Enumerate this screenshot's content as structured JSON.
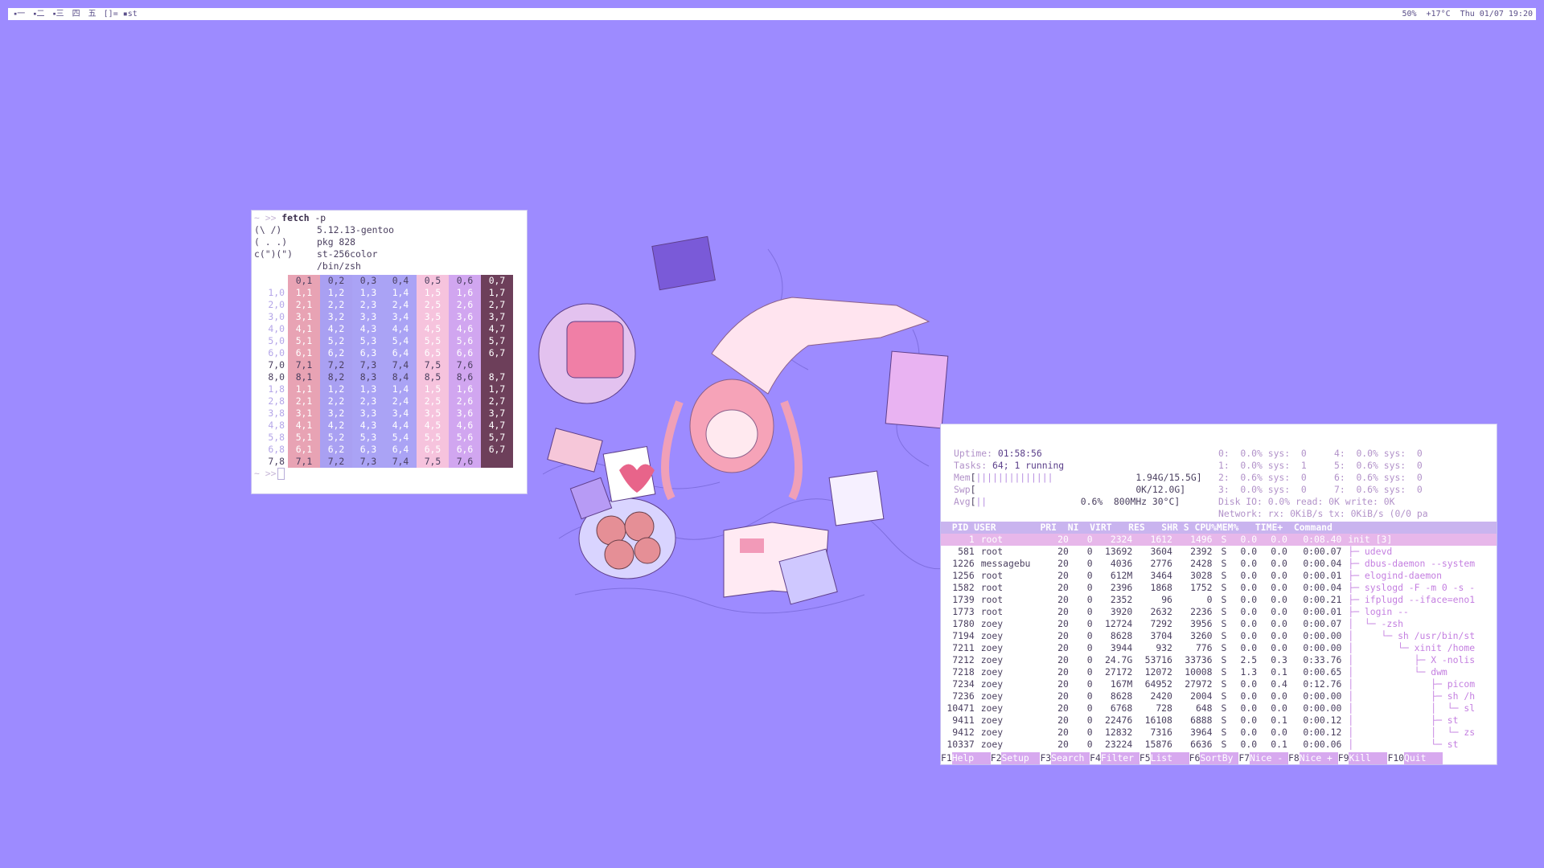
{
  "topbar": {
    "tags": [
      "一",
      "二",
      "三",
      "四",
      "五"
    ],
    "layout": "[]=",
    "window_title": "st",
    "status": "50%  +17°C  Thu 01/07 19:20"
  },
  "fetch": {
    "prompt": "~ >>",
    "command": "fetch",
    "arg": "-p",
    "art": [
      "(\\ /)",
      "( . .)",
      "c(\")(\")",
      ""
    ],
    "info": [
      "5.12.13-gentoo",
      "pkg 828",
      "st-256color",
      "/bin/zsh"
    ],
    "grid_header": [
      "",
      "0,1",
      "0,2",
      "0,3",
      "0,4",
      "0,5",
      "0,6",
      "0,7"
    ],
    "grid_rows": [
      [
        "1,0",
        "1,1",
        "1,2",
        "1,3",
        "1,4",
        "1,5",
        "1,6",
        "1,7"
      ],
      [
        "2,0",
        "2,1",
        "2,2",
        "2,3",
        "2,4",
        "2,5",
        "2,6",
        "2,7"
      ],
      [
        "3,0",
        "3,1",
        "3,2",
        "3,3",
        "3,4",
        "3,5",
        "3,6",
        "3,7"
      ],
      [
        "4,0",
        "4,1",
        "4,2",
        "4,3",
        "4,4",
        "4,5",
        "4,6",
        "4,7"
      ],
      [
        "5,0",
        "5,1",
        "5,2",
        "5,3",
        "5,4",
        "5,5",
        "5,6",
        "5,7"
      ],
      [
        "6,0",
        "6,1",
        "6,2",
        "6,3",
        "6,4",
        "6,5",
        "6,6",
        "6,7"
      ],
      [
        "7,0",
        "7,1",
        "7,2",
        "7,3",
        "7,4",
        "7,5",
        "7,6",
        ""
      ],
      [
        "8,0",
        "8,1",
        "8,2",
        "8,3",
        "8,4",
        "8,5",
        "8,6",
        "8,7"
      ],
      [
        "1,8",
        "1,1",
        "1,2",
        "1,3",
        "1,4",
        "1,5",
        "1,6",
        "1,7"
      ],
      [
        "2,8",
        "2,1",
        "2,2",
        "2,3",
        "2,4",
        "2,5",
        "2,6",
        "2,7"
      ],
      [
        "3,8",
        "3,1",
        "3,2",
        "3,3",
        "3,4",
        "3,5",
        "3,6",
        "3,7"
      ],
      [
        "4,8",
        "4,1",
        "4,2",
        "4,3",
        "4,4",
        "4,5",
        "4,6",
        "4,7"
      ],
      [
        "5,8",
        "5,1",
        "5,2",
        "5,3",
        "5,4",
        "5,5",
        "5,6",
        "5,7"
      ],
      [
        "6,8",
        "6,1",
        "6,2",
        "6,3",
        "6,4",
        "6,5",
        "6,6",
        "6,7"
      ],
      [
        "7,8",
        "7,1",
        "7,2",
        "7,3",
        "7,4",
        "7,5",
        "7,6",
        ""
      ]
    ],
    "column_colors": [
      "#ffffff",
      "#e8a3b4",
      "#a9a0f2",
      "#aaa3f5",
      "#aaa3f5",
      "#f6c3dd",
      "#d1a6f0",
      "#6d3f5a"
    ]
  },
  "htop": {
    "uptime_label": "Uptime:",
    "uptime": "01:58:56",
    "tasks_label": "Tasks:",
    "tasks": "64; 1 running",
    "mem_label": "Mem",
    "mem_bar": "||||||||||||||",
    "mem_val": "1.94G/15.5G",
    "swp_label": "Swp",
    "swp_val": "0K/12.0G",
    "avg_label": "Avg",
    "avg_bar": "||",
    "avg_val": "0.6%  800MHz 30°C",
    "disk": "Disk IO: 0.0% read: 0K write: 0K",
    "network": "Network: rx: 0KiB/s tx: 0KiB/s (0/0 pa",
    "cpus": [
      "0:  0.0% sys:  0     4:  0.0% sys:  0",
      "1:  0.0% sys:  1     5:  0.6% sys:  0",
      "2:  0.6% sys:  0     6:  0.6% sys:  0",
      "3:  0.0% sys:  0     7:  0.6% sys:  0"
    ],
    "header": "  PID USER        PRI  NI  VIRT   RES   SHR S CPU%MEM%   TIME+  Command",
    "processes": [
      {
        "pid": "1",
        "user": "root",
        "pri": "20",
        "ni": "0",
        "virt": "2324",
        "res": "1612",
        "shr": "1496",
        "s": "S",
        "cpu": "0.0",
        "mem": "0.0",
        "time": "0:08.40",
        "cmd": "init [3]",
        "sel": true
      },
      {
        "pid": "581",
        "user": "root",
        "pri": "20",
        "ni": "0",
        "virt": "13692",
        "res": "3604",
        "shr": "2392",
        "s": "S",
        "cpu": "0.0",
        "mem": "0.0",
        "time": "0:00.07",
        "cmd": "├─ udevd"
      },
      {
        "pid": "1226",
        "user": "messagebu",
        "pri": "20",
        "ni": "0",
        "virt": "4036",
        "res": "2776",
        "shr": "2428",
        "s": "S",
        "cpu": "0.0",
        "mem": "0.0",
        "time": "0:00.04",
        "cmd": "├─ dbus-daemon --system"
      },
      {
        "pid": "1256",
        "user": "root",
        "pri": "20",
        "ni": "0",
        "virt": "612M",
        "res": "3464",
        "shr": "3028",
        "s": "S",
        "cpu": "0.0",
        "mem": "0.0",
        "time": "0:00.01",
        "cmd": "├─ elogind-daemon"
      },
      {
        "pid": "1582",
        "user": "root",
        "pri": "20",
        "ni": "0",
        "virt": "2396",
        "res": "1868",
        "shr": "1752",
        "s": "S",
        "cpu": "0.0",
        "mem": "0.0",
        "time": "0:00.04",
        "cmd": "├─ syslogd -F -m 0 -s -"
      },
      {
        "pid": "1739",
        "user": "root",
        "pri": "20",
        "ni": "0",
        "virt": "2352",
        "res": "96",
        "shr": "0",
        "s": "S",
        "cpu": "0.0",
        "mem": "0.0",
        "time": "0:00.21",
        "cmd": "├─ ifplugd --iface=eno1"
      },
      {
        "pid": "1773",
        "user": "root",
        "pri": "20",
        "ni": "0",
        "virt": "3920",
        "res": "2632",
        "shr": "2236",
        "s": "S",
        "cpu": "0.0",
        "mem": "0.0",
        "time": "0:00.01",
        "cmd": "├─ login --"
      },
      {
        "pid": "1780",
        "user": "zoey",
        "pri": "20",
        "ni": "0",
        "virt": "12724",
        "res": "7292",
        "shr": "3956",
        "s": "S",
        "cpu": "0.0",
        "mem": "0.0",
        "time": "0:00.07",
        "cmd": "│  └─ -zsh"
      },
      {
        "pid": "7194",
        "user": "zoey",
        "pri": "20",
        "ni": "0",
        "virt": "8628",
        "res": "3704",
        "shr": "3260",
        "s": "S",
        "cpu": "0.0",
        "mem": "0.0",
        "time": "0:00.00",
        "cmd": "│     └─ sh /usr/bin/st"
      },
      {
        "pid": "7211",
        "user": "zoey",
        "pri": "20",
        "ni": "0",
        "virt": "3944",
        "res": "932",
        "shr": "776",
        "s": "S",
        "cpu": "0.0",
        "mem": "0.0",
        "time": "0:00.00",
        "cmd": "│        └─ xinit /home"
      },
      {
        "pid": "7212",
        "user": "zoey",
        "pri": "20",
        "ni": "0",
        "virt": "24.7G",
        "res": "53716",
        "shr": "33736",
        "s": "S",
        "cpu": "2.5",
        "mem": "0.3",
        "time": "0:33.76",
        "cmd": "│           ├─ X -nolis"
      },
      {
        "pid": "7218",
        "user": "zoey",
        "pri": "20",
        "ni": "0",
        "virt": "27172",
        "res": "12072",
        "shr": "10008",
        "s": "S",
        "cpu": "1.3",
        "mem": "0.1",
        "time": "0:00.65",
        "cmd": "│           └─ dwm"
      },
      {
        "pid": "7234",
        "user": "zoey",
        "pri": "20",
        "ni": "0",
        "virt": "167M",
        "res": "64952",
        "shr": "27972",
        "s": "S",
        "cpu": "0.0",
        "mem": "0.4",
        "time": "0:12.76",
        "cmd": "│              ├─ picom"
      },
      {
        "pid": "7236",
        "user": "zoey",
        "pri": "20",
        "ni": "0",
        "virt": "8628",
        "res": "2420",
        "shr": "2004",
        "s": "S",
        "cpu": "0.0",
        "mem": "0.0",
        "time": "0:00.00",
        "cmd": "│              ├─ sh /h"
      },
      {
        "pid": "10471",
        "user": "zoey",
        "pri": "20",
        "ni": "0",
        "virt": "6768",
        "res": "728",
        "shr": "648",
        "s": "S",
        "cpu": "0.0",
        "mem": "0.0",
        "time": "0:00.00",
        "cmd": "│              │  └─ sl"
      },
      {
        "pid": "9411",
        "user": "zoey",
        "pri": "20",
        "ni": "0",
        "virt": "22476",
        "res": "16108",
        "shr": "6888",
        "s": "S",
        "cpu": "0.0",
        "mem": "0.1",
        "time": "0:00.12",
        "cmd": "│              ├─ st"
      },
      {
        "pid": "9412",
        "user": "zoey",
        "pri": "20",
        "ni": "0",
        "virt": "12832",
        "res": "7316",
        "shr": "3964",
        "s": "S",
        "cpu": "0.0",
        "mem": "0.0",
        "time": "0:00.12",
        "cmd": "│              │  └─ zs"
      },
      {
        "pid": "10337",
        "user": "zoey",
        "pri": "20",
        "ni": "0",
        "virt": "23224",
        "res": "15876",
        "shr": "6636",
        "s": "S",
        "cpu": "0.0",
        "mem": "0.1",
        "time": "0:00.06",
        "cmd": "│              └─ st"
      }
    ],
    "fkeys": [
      {
        "k": "F1",
        "l": "Help"
      },
      {
        "k": "F2",
        "l": "Setup"
      },
      {
        "k": "F3",
        "l": "Search"
      },
      {
        "k": "F4",
        "l": "Filter"
      },
      {
        "k": "F5",
        "l": "List"
      },
      {
        "k": "F6",
        "l": "SortBy"
      },
      {
        "k": "F7",
        "l": "Nice -"
      },
      {
        "k": "F8",
        "l": "Nice +"
      },
      {
        "k": "F9",
        "l": "Kill"
      },
      {
        "k": "F10",
        "l": "Quit"
      }
    ]
  }
}
